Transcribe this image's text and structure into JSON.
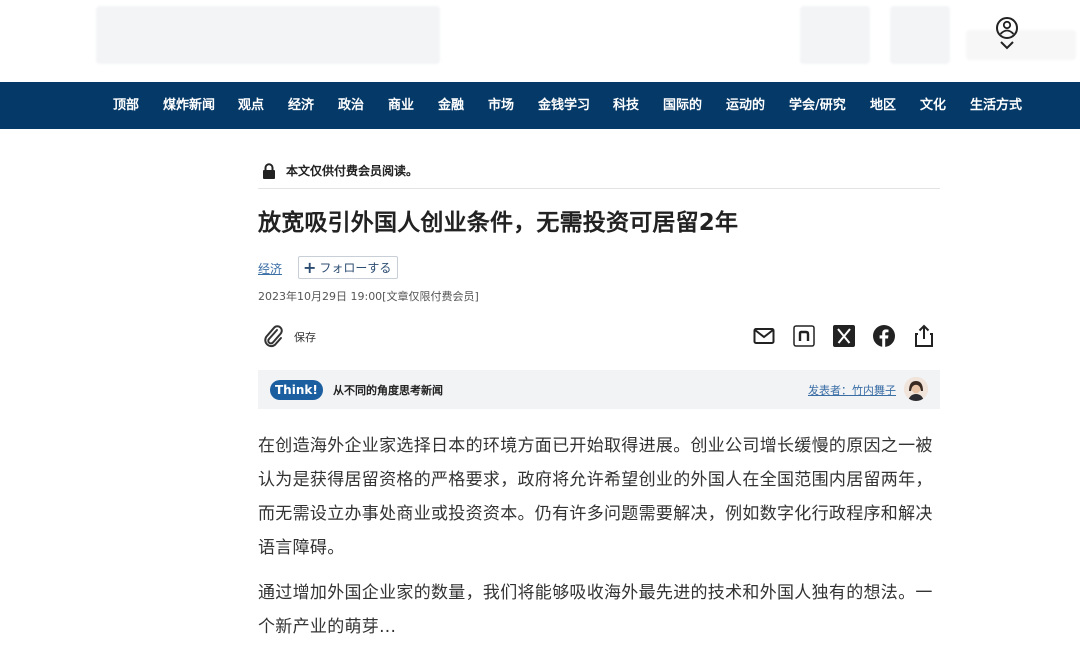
{
  "nav": {
    "items": [
      "顶部",
      "煤炸新闻",
      "观点",
      "经济",
      "政治",
      "商业",
      "金融",
      "市场",
      "金钱学习",
      "科技",
      "国际的",
      "运动的",
      "学会/研究",
      "地区",
      "文化",
      "生活方式"
    ]
  },
  "notice": {
    "text": "本文仅供付费会员阅读。"
  },
  "article": {
    "headline": "放宽吸引外国人创业条件，无需投资可居留2年",
    "topic": "经济",
    "follow_label": "フォローする",
    "date": "2023年10月29日 19:00[文章仅限付费会员]",
    "save_label": "保存",
    "paragraphs": [
      "在创造海外企业家选择日本的环境方面已开始取得进展。创业公司增长缓慢的原因之一被认为是获得居留资格的严格要求，政府将允许希望创业的外国人在全国范围内居留两年，而无需设立办事处商业或投资资本。仍有许多问题需要解决，例如数字化行政程序和解决语言障碍。",
      "通过增加外国企业家的数量，我们将能够吸收海外最先进的技术和外国人独有的想法。一个新产业的萌芽..."
    ]
  },
  "think": {
    "badge": "Think!",
    "description": "从不同的角度思考新闻",
    "author": "发表者：竹内舞子"
  },
  "share_icons": [
    "mail-icon",
    "note-icon",
    "x-icon",
    "facebook-icon",
    "share-icon"
  ],
  "colors": {
    "nav_bg": "#053968",
    "accent": "#1b5fa0",
    "link": "#3a6ea5"
  }
}
